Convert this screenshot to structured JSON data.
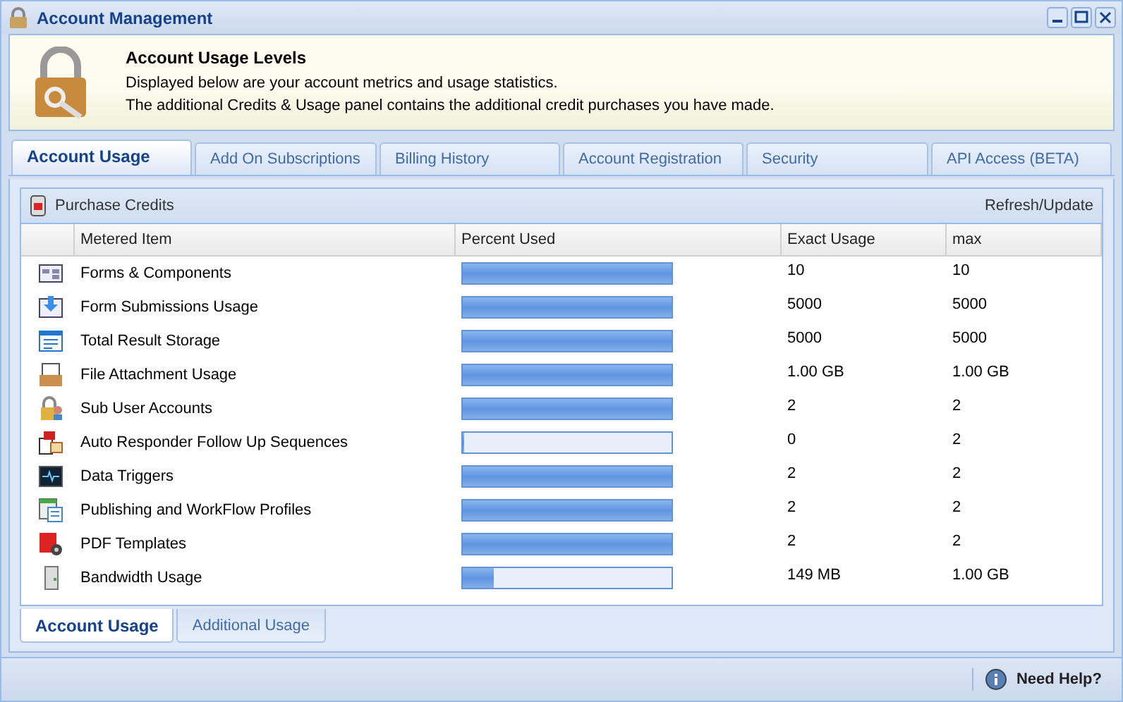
{
  "window": {
    "title": "Account Management"
  },
  "header": {
    "title": "Account Usage Levels",
    "lines": [
      "Displayed below are your account metrics and usage statistics.",
      "The additional Credits & Usage panel contains the additional credit purchases you have made."
    ]
  },
  "tabs": [
    {
      "label": "Account Usage",
      "selected": true
    },
    {
      "label": "Add On Subscriptions",
      "selected": false
    },
    {
      "label": "Billing History",
      "selected": false
    },
    {
      "label": "Account Registration",
      "selected": false
    },
    {
      "label": "Security",
      "selected": false
    },
    {
      "label": "API Access (BETA)",
      "selected": false
    }
  ],
  "toolbar": {
    "purchase": "Purchase Credits",
    "refresh": "Refresh/Update"
  },
  "table": {
    "columns": [
      "Metered Item",
      "Percent Used",
      "Exact Usage",
      "max"
    ],
    "rows": [
      {
        "item": "Forms & Components",
        "level": 1,
        "exact": "10",
        "max": "10"
      },
      {
        "item": "Form Submissions Usage",
        "level": 1,
        "exact": "5000",
        "max": "5000"
      },
      {
        "item": "Total Result Storage",
        "level": 1,
        "exact": "5000",
        "max": "5000"
      },
      {
        "item": "File Attachment Usage",
        "level": 1,
        "exact": "1.00 GB",
        "max": "1.00 GB"
      },
      {
        "item": "Sub User Accounts",
        "level": 1,
        "exact": "2",
        "max": "2"
      },
      {
        "item": "Auto Responder Follow Up Sequences",
        "level": 0,
        "exact": "0",
        "max": "2"
      },
      {
        "item": "Data Triggers",
        "level": 1,
        "exact": "2",
        "max": "2"
      },
      {
        "item": "Publishing and WorkFlow Profiles",
        "level": 1,
        "exact": "2",
        "max": "2"
      },
      {
        "item": "PDF Templates",
        "level": 1,
        "exact": "2",
        "max": "2"
      },
      {
        "item": "Bandwidth Usage",
        "level": 0.15,
        "exact": "149 MB",
        "max": "1.00 GB"
      }
    ]
  },
  "bottom_tabs": [
    {
      "label": "Account Usage",
      "selected": true
    },
    {
      "label": "Additional Usage",
      "selected": false
    }
  ],
  "footer": {
    "help": "Need Help?"
  }
}
